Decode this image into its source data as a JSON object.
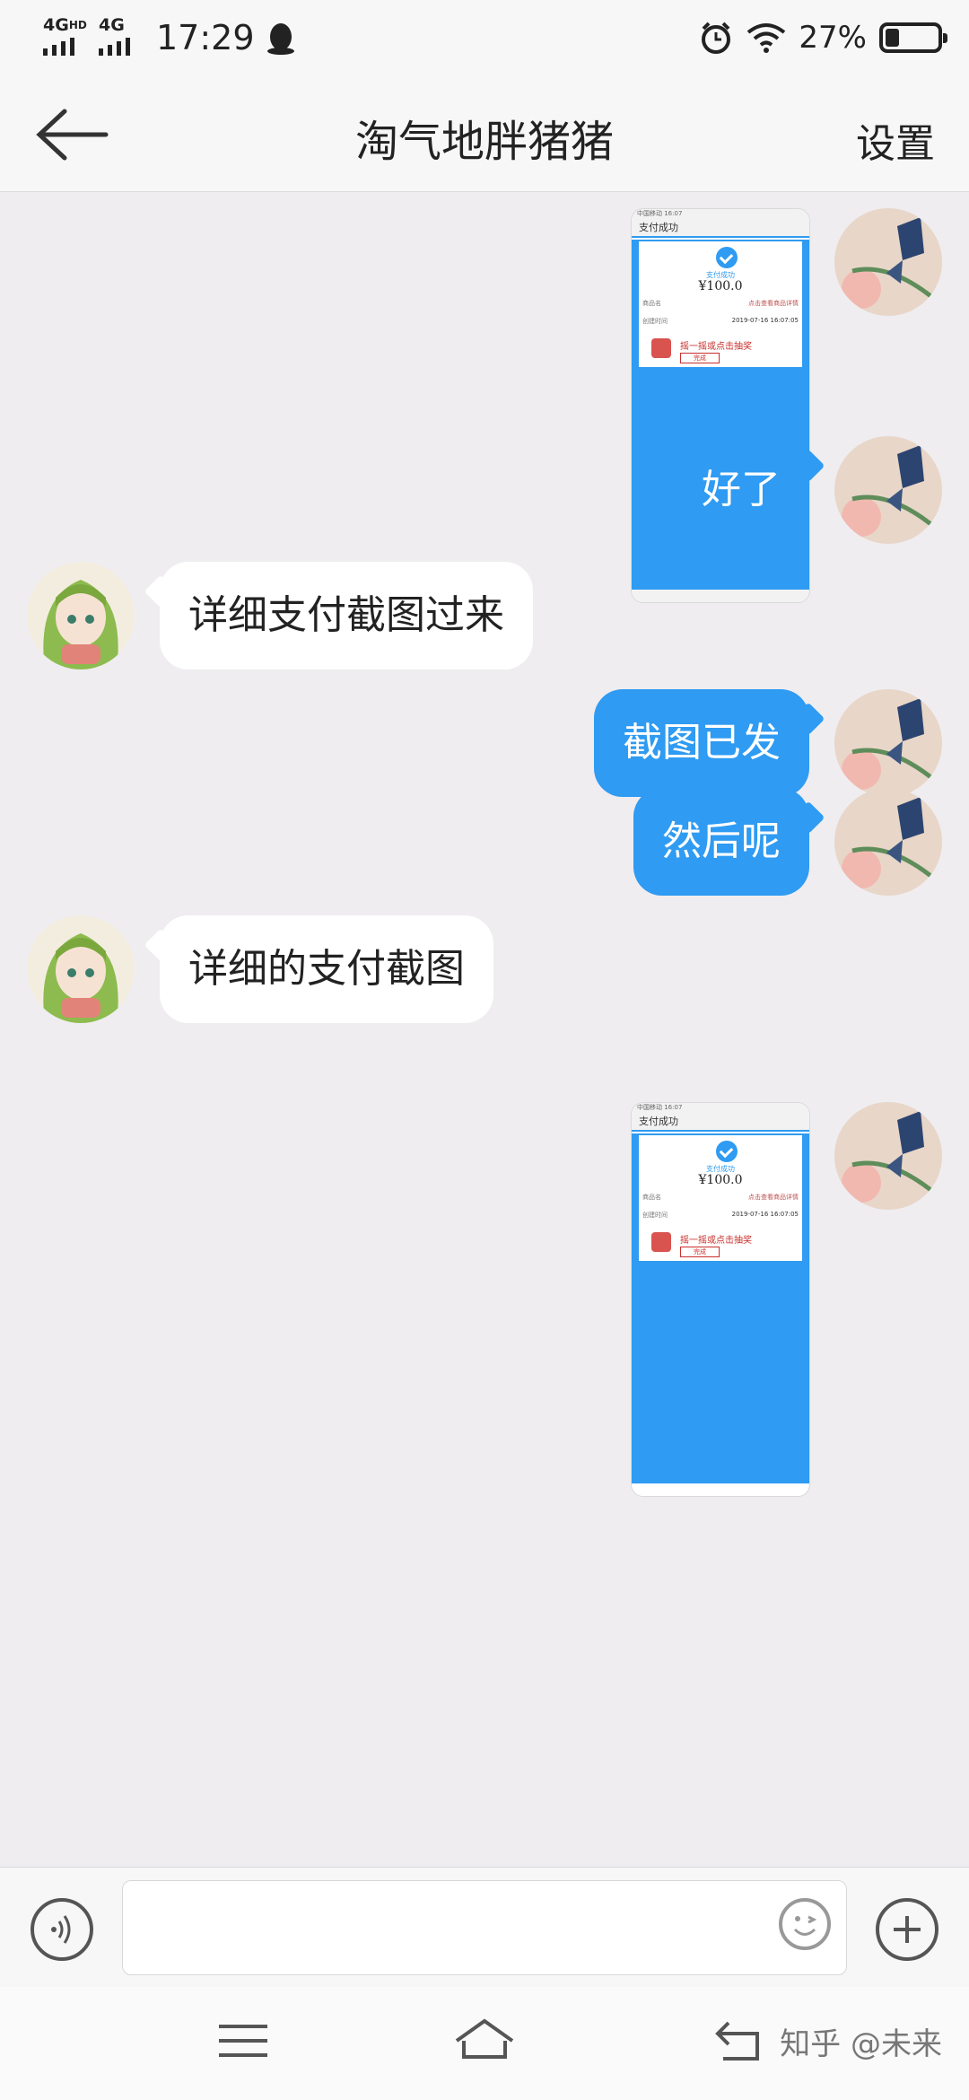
{
  "status_bar": {
    "network1": "4G",
    "network1_sup": "HD",
    "network2": "4G",
    "time": "17:29",
    "battery_percent": "27%",
    "battery_level": 0.27
  },
  "nav": {
    "title": "淘气地胖猪猪",
    "settings": "设置"
  },
  "screenshot_card": {
    "status": "中国移动 16:07",
    "header": "支付成功",
    "success_text": "支付成功",
    "amount": "¥100.0",
    "merchant_label": "商品名",
    "merchant_value": "点击查看商品详情",
    "time_label": "创建时间",
    "time_value": "2019-07-16 16:07:05",
    "promo": "摇一摇或点击抽奖",
    "button": "完成"
  },
  "messages": [
    {
      "side": "out",
      "type": "image"
    },
    {
      "side": "out",
      "type": "text",
      "text": "好了"
    },
    {
      "side": "in",
      "type": "text",
      "text": "详细支付截图过来"
    },
    {
      "side": "out",
      "type": "text",
      "text": "截图已发"
    },
    {
      "side": "out",
      "type": "text",
      "text": "然后呢"
    },
    {
      "side": "in",
      "type": "text",
      "text": "详细的支付截图"
    },
    {
      "side": "out",
      "type": "image"
    }
  ],
  "input": {
    "value": "",
    "placeholder": ""
  },
  "colors": {
    "accent": "#2f9bf2",
    "chat_bg": "#efedf0",
    "bar_bg": "#f7f7f7"
  },
  "icons": {
    "back": "back-arrow-icon",
    "voice": "voice-icon",
    "emoji": "emoji-icon",
    "plus": "plus-icon",
    "menu": "menu-icon",
    "home": "home-icon",
    "return": "return-icon"
  },
  "watermark": "知乎 @未来"
}
